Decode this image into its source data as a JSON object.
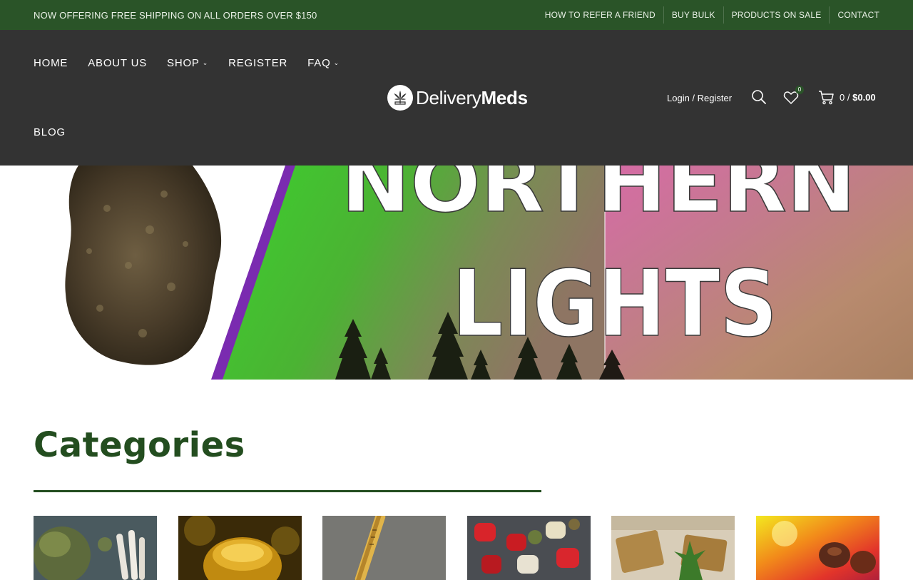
{
  "topbar": {
    "promo": "NOW OFFERING FREE SHIPPING ON ALL ORDERS OVER $150",
    "links": [
      "HOW TO REFER A FRIEND",
      "BUY BULK",
      "PRODUCTS ON SALE",
      "CONTACT"
    ]
  },
  "nav": {
    "items": [
      "HOME",
      "ABOUT US",
      "SHOP",
      "REGISTER",
      "FAQ"
    ],
    "blog": "BLOG"
  },
  "logo": {
    "light": "Delivery",
    "bold": "Meds"
  },
  "header": {
    "login": "Login / Register",
    "wishlist_count": "0",
    "cart_count": "0",
    "cart_sep": "/",
    "cart_total": "$0.00"
  },
  "hero": {
    "line1": "NORTHERN",
    "line2": "LIGHTS"
  },
  "categories": {
    "title": "Categories"
  },
  "colors": {
    "topbar": "#2a5428",
    "header": "#333333",
    "accent": "#234d1f"
  },
  "icons": [
    "search-icon",
    "heart-icon",
    "cart-icon",
    "chevron-down-icon",
    "cannabis-leaf-icon"
  ]
}
